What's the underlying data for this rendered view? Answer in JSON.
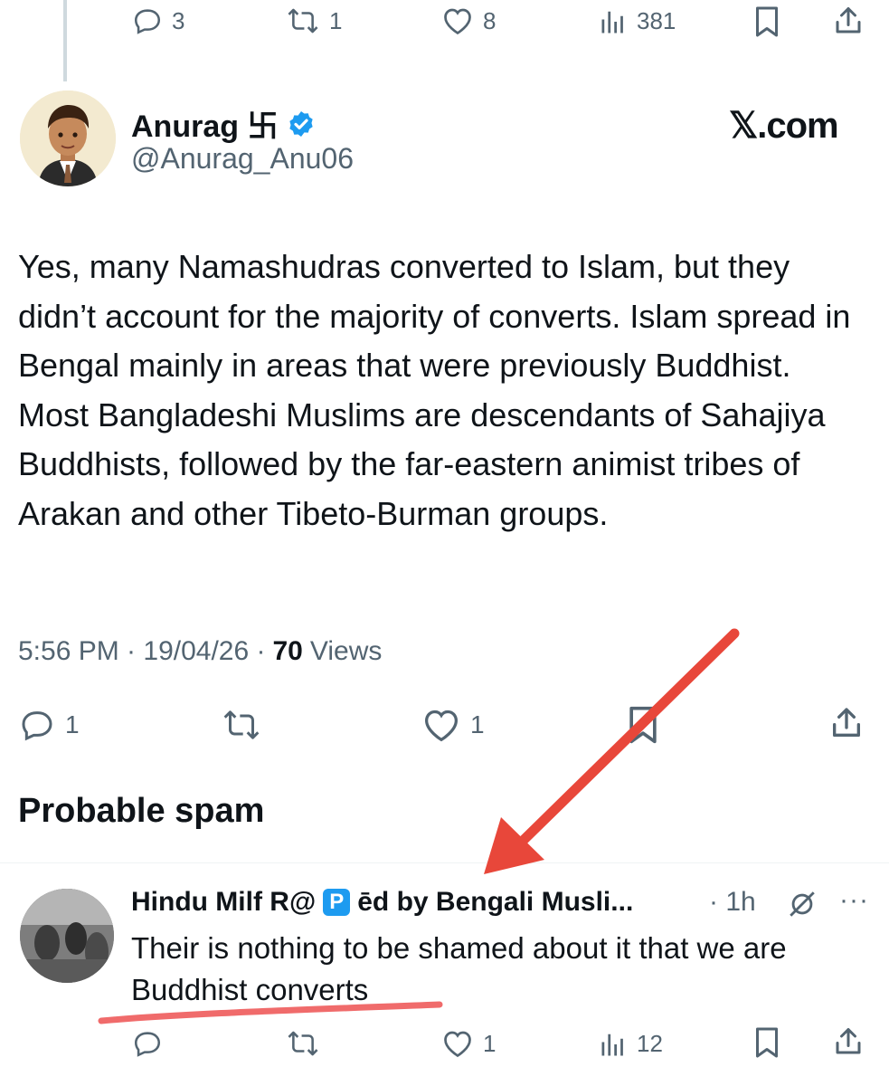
{
  "top_actions": {
    "replies": "3",
    "reposts": "1",
    "likes": "8",
    "views": "381"
  },
  "tweet": {
    "author_name": "Anurag 卐",
    "handle": "@Anurag_Anu06",
    "brand": "𝕏.com",
    "text": "Yes, many Namashudras converted to Islam, but they didn’t account for the majority of converts. Islam spread in Bengal mainly in areas that were previously Buddhist. Most Bangladeshi Muslims are descendants of Sahajiya Buddhists, followed by the far-eastern animist tribes of Arakan and other Tibeto-Burman groups.",
    "time": "5:56 PM · 19/04/26 ·",
    "views_count": "70",
    "views_label": "Views",
    "replies": "1",
    "likes": "1"
  },
  "section_title": "Probable spam",
  "reply": {
    "name_part1": "Hindu Milf R@",
    "badge": "P",
    "name_part2": "ēd by Bengali Musli...",
    "time": "· 1h",
    "more": "···",
    "text_line1": "Their is nothing to be shamed about it that we are",
    "text_line2": "Buddhist converts",
    "likes": "1",
    "views": "12"
  },
  "colors": {
    "annotation_red": "#e8473a",
    "underline_red": "#f06b6b",
    "verified_blue": "#1d9bf0",
    "icon_gray": "#536471"
  }
}
